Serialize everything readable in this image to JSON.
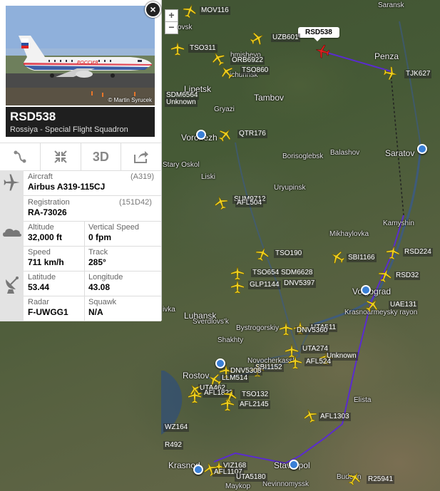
{
  "map": {
    "zoom_in": "+",
    "zoom_out": "−",
    "selected_callout": "RSD538",
    "places": [
      {
        "name": "Saransk"
      },
      {
        "name": "Penza"
      },
      {
        "name": "Lipetsk"
      },
      {
        "name": "Tambov"
      },
      {
        "name": "Gryazi"
      },
      {
        "name": "Voronezh"
      },
      {
        "name": "Saratov"
      },
      {
        "name": "Stary Oskol"
      },
      {
        "name": "Borisoglebsk"
      },
      {
        "name": "Balashov"
      },
      {
        "name": "Liski"
      },
      {
        "name": "Uryupinsk"
      },
      {
        "name": "Kamyshin"
      },
      {
        "name": "Mikhaylovka"
      },
      {
        "name": "Luhansk"
      },
      {
        "name": "Volgograd"
      },
      {
        "name": "Krasnoarmeysky rayon"
      },
      {
        "name": "Sverdlovs'k"
      },
      {
        "name": "Bystrogorskiy"
      },
      {
        "name": "Shakhty"
      },
      {
        "name": "Novocherkassk"
      },
      {
        "name": "Rostov"
      },
      {
        "name": "Elista"
      },
      {
        "name": "Krasnod"
      },
      {
        "name": "Stavropol"
      },
      {
        "name": "Nevinnomyssk"
      },
      {
        "name": "Budenn"
      },
      {
        "name": "Maykop"
      },
      {
        "name": "ivka"
      },
      {
        "name": "ovsk"
      },
      {
        "name": "hmishevo"
      },
      {
        "name": "ichurinsk"
      }
    ],
    "flights": [
      {
        "label": "MOV116"
      },
      {
        "label": "UZB601"
      },
      {
        "label": "TSO311"
      },
      {
        "label": "ORB6922"
      },
      {
        "label": "TSO860"
      },
      {
        "label": "TJK627"
      },
      {
        "label": "SDM6564"
      },
      {
        "label": "Unknown"
      },
      {
        "label": "QTR176"
      },
      {
        "label": "SUM9712"
      },
      {
        "label": "AFL504"
      },
      {
        "label": "TSO190"
      },
      {
        "label": "SBI1166"
      },
      {
        "label": "RSD224"
      },
      {
        "label": "TSO654"
      },
      {
        "label": "SDM6628"
      },
      {
        "label": "RSD32"
      },
      {
        "label": "GLP1144"
      },
      {
        "label": "DNV5397"
      },
      {
        "label": "UAE131"
      },
      {
        "label": "UTA511"
      },
      {
        "label": "DNV5360"
      },
      {
        "label": "UTA274"
      },
      {
        "label": "Unknown"
      },
      {
        "label": "AFL524"
      },
      {
        "label": "SBI1152"
      },
      {
        "label": "DNV5308"
      },
      {
        "label": "LLM514"
      },
      {
        "label": "UTA462"
      },
      {
        "label": "AFL1823"
      },
      {
        "label": "TSO132"
      },
      {
        "label": "AFL2145"
      },
      {
        "label": "AFL1303"
      },
      {
        "label": "WZ164"
      },
      {
        "label": "R492"
      },
      {
        "label": "VIZ168"
      },
      {
        "label": "AFL1107"
      },
      {
        "label": "UTA5180"
      },
      {
        "label": "R25941"
      }
    ]
  },
  "panel": {
    "photo_credit": "© Martin Syrucek",
    "callsign": "RSD538",
    "airline": "Rossiya - Special Flight Squadron",
    "tools": [
      "route",
      "fullscreen",
      "3D",
      "share"
    ],
    "tool_3d_label": "3D",
    "aircraft": {
      "label": "Aircraft",
      "code": "(A319)",
      "value": "Airbus A319-115CJ"
    },
    "registration": {
      "label": "Registration",
      "code": "(151D42)",
      "value": "RA-73026"
    },
    "altitude": {
      "label": "Altitude",
      "value": "32,000 ft"
    },
    "vertical_speed": {
      "label": "Vertical Speed",
      "value": "0 fpm"
    },
    "speed": {
      "label": "Speed",
      "value": "711 km/h"
    },
    "track": {
      "label": "Track",
      "value": "285°"
    },
    "latitude": {
      "label": "Latitude",
      "value": "53.44"
    },
    "longitude": {
      "label": "Longitude",
      "value": "43.08"
    },
    "radar": {
      "label": "Radar",
      "value": "F-UWGG1"
    },
    "squawk": {
      "label": "Squawk",
      "value": "N/A"
    }
  },
  "colors": {
    "route": "#5a2bd0",
    "plane": "#f0d020",
    "selected_plane": "#e02020",
    "pin": "#3a7fd6"
  }
}
